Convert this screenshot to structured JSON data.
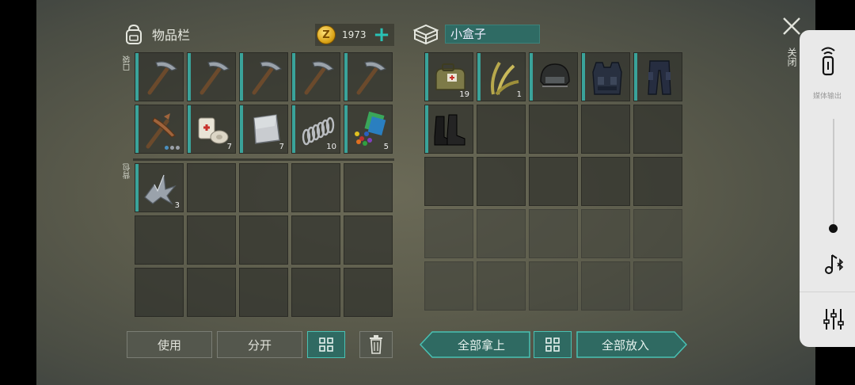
{
  "inventory": {
    "title": "物品栏",
    "pocket_label": "口袋",
    "backpack_label": "背包",
    "coins": "1973",
    "coin_symbol": "Z",
    "plus": "+",
    "pocket_slots": [
      {
        "icon": "pickaxe-icon",
        "qty": ""
      },
      {
        "icon": "pickaxe-icon",
        "qty": ""
      },
      {
        "icon": "pickaxe-icon",
        "qty": ""
      },
      {
        "icon": "pickaxe-icon",
        "qty": ""
      },
      {
        "icon": "pickaxe-icon",
        "qty": ""
      },
      {
        "icon": "copper-pickaxe-icon",
        "qty": ""
      },
      {
        "icon": "bandage-icon",
        "qty": "7"
      },
      {
        "icon": "metal-plate-icon",
        "qty": "7"
      },
      {
        "icon": "spring-icon",
        "qty": "10"
      },
      {
        "icon": "electronics-icon",
        "qty": "5"
      }
    ],
    "backpack_slots": [
      {
        "icon": "scrap-metal-icon",
        "qty": "3"
      }
    ]
  },
  "box": {
    "title": "小盒子",
    "slots": [
      {
        "icon": "medkit-bag-icon",
        "qty": "19"
      },
      {
        "icon": "plant-fiber-icon",
        "qty": "1"
      },
      {
        "icon": "tactical-helmet-icon",
        "qty": ""
      },
      {
        "icon": "tactical-vest-icon",
        "qty": ""
      },
      {
        "icon": "tactical-pants-icon",
        "qty": ""
      },
      {
        "icon": "boots-icon",
        "qty": ""
      }
    ]
  },
  "buttons": {
    "use": "使用",
    "split": "分开",
    "take_all": "全部拿上",
    "put_all": "全部放入"
  },
  "close_label": "关闭",
  "media_panel": {
    "output_label": "媒体输出"
  },
  "colors": {
    "accent": "#3aa39a",
    "button_teal": "#2f6a62",
    "coin": "#d9a215"
  }
}
